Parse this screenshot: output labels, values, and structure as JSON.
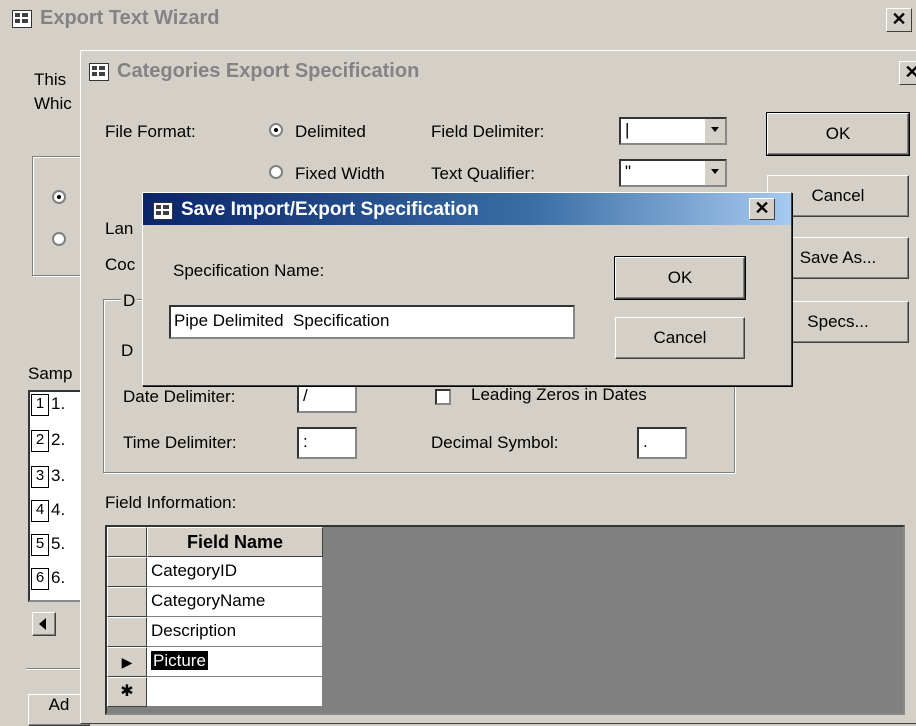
{
  "wizard": {
    "title": "Export Text Wizard",
    "close_glyph": "✕",
    "intro_line1": "This",
    "intro_line2": "Whic",
    "sample_label": "Samp",
    "sample_rows": [
      "1",
      "2",
      "3",
      "4",
      "5",
      "6"
    ],
    "sample_vals": [
      "1.",
      "2.",
      "3.",
      "4.",
      "5.",
      "6."
    ],
    "adv_stub": "Ad"
  },
  "spec": {
    "title": "Categories Export Specification",
    "close_glyph": "✕",
    "file_format_label": "File Format:",
    "delimited_label": "Delimited",
    "fixed_width_label": "Fixed Width",
    "field_delimiter_label": "Field Delimiter:",
    "field_delimiter_value": "|",
    "text_qualifier_label": "Text Qualifier:",
    "text_qualifier_value": "\"",
    "language_stub": "Lan",
    "codepage_stub": "Coc",
    "dates_group_stub": "D",
    "date_order_stub": "D",
    "date_delimiter_label": "Date Delimiter:",
    "date_delimiter_value": "/",
    "leading_zeros_label": "Leading Zeros in Dates",
    "time_delimiter_label": "Time Delimiter:",
    "time_delimiter_value": ":",
    "decimal_symbol_label": "Decimal Symbol:",
    "decimal_symbol_value": ".",
    "field_info_label": "Field Information:",
    "ok_label": "OK",
    "cancel_label": "Cancel",
    "save_as_label": "Save As...",
    "specs_label": "Specs...",
    "grid": {
      "column_header": "Field Name",
      "rows": [
        "CategoryID",
        "CategoryName",
        "Description",
        "Picture"
      ],
      "selected_row_marker": "▶",
      "new_row_marker": "✱"
    }
  },
  "save_dialog": {
    "title": "Save Import/Export Specification",
    "close_glyph": "✕",
    "name_label": "Specification Name:",
    "name_value": "Pipe Delimited  Specification",
    "ok_label": "OK",
    "cancel_label": "Cancel"
  },
  "colors": {
    "active_title_start": "#0a246a",
    "active_title_end": "#a6caf0",
    "face": "#d4d0c8"
  }
}
